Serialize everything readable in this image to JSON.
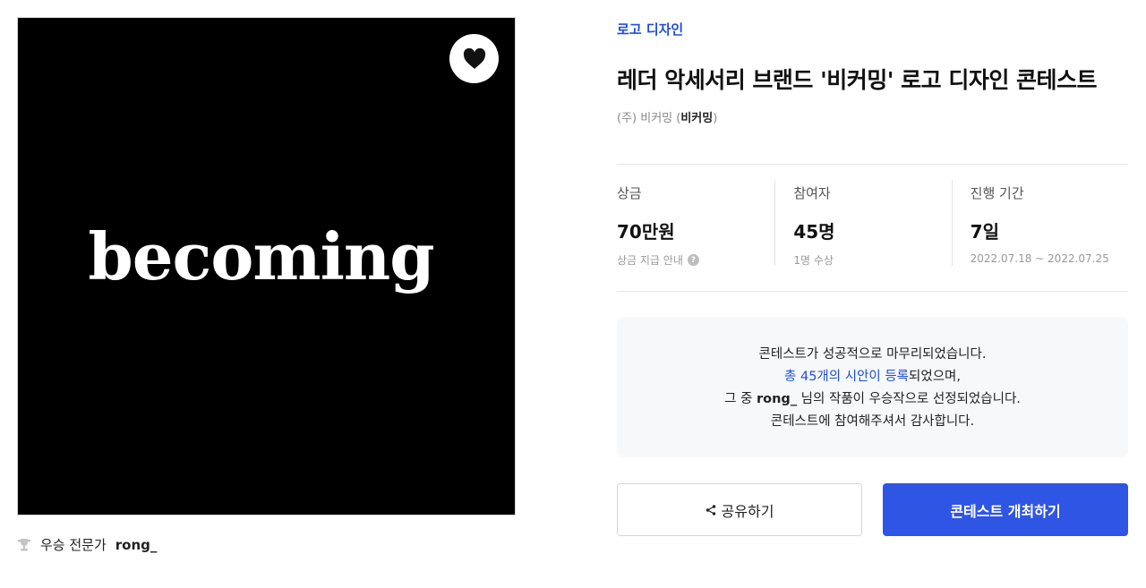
{
  "hero": {
    "wordmark": "becoming"
  },
  "winner": {
    "label": "우승 전문가",
    "name": "rong_"
  },
  "contest": {
    "category": "로고 디자인",
    "title": "레더 악세서리 브랜드 '비커밍' 로고 디자인 콘테스트",
    "host_company": "(주) 비커밍",
    "host_brand": "비커밍"
  },
  "stats": [
    {
      "label": "상금",
      "value": "70만원",
      "sub": "상금 지급 안내"
    },
    {
      "label": "참여자",
      "value": "45명",
      "sub": "1명 수상"
    },
    {
      "label": "진행 기간",
      "value": "7일",
      "sub": "2022.07.18 ~ 2022.07.25"
    }
  ],
  "notice": {
    "line1": "콘테스트가 성공적으로 마무리되었습니다.",
    "line2_highlight": "총 45개의 시안이 등록",
    "line2_rest": "되었으며,",
    "line3_pre": "그 중 ",
    "line3_name": "rong_",
    "line3_post": " 님의 작품이 우승작으로 선정되었습니다.",
    "line4": "콘테스트에 참여해주셔서 감사합니다."
  },
  "buttons": {
    "share": "공유하기",
    "host": "콘테스트 개최하기"
  },
  "colors": {
    "accent": "#2f55e4",
    "link": "#1f4ed8"
  }
}
